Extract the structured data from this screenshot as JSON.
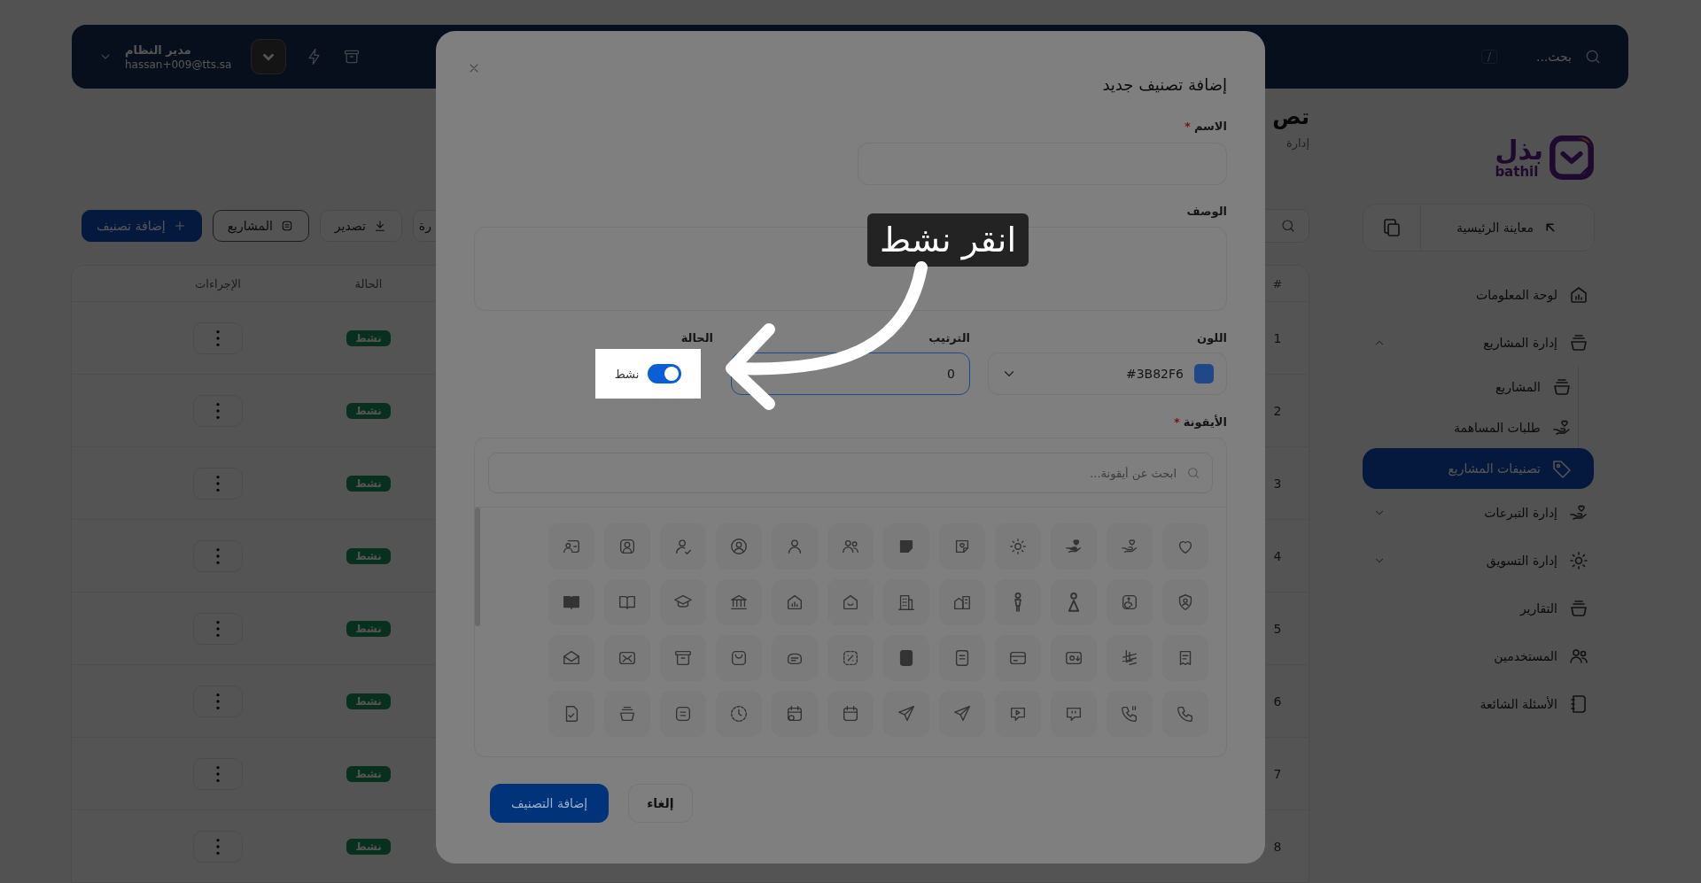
{
  "topbar": {
    "search_placeholder": "بحث...",
    "shortcut": "/",
    "user": {
      "name": "مدير النظام",
      "email": "hassan+009@tts.sa"
    }
  },
  "sidebar": {
    "logo": {
      "arabic": "بذل",
      "latin": "bathil"
    },
    "preview_button": "معاينة الرئيسية",
    "items": [
      {
        "label": "لوحة المعلومات",
        "selected": false
      },
      {
        "label": "إدارة المشاريع",
        "selected": false,
        "expanded": true,
        "children": [
          {
            "label": "المشاريع",
            "selected": false
          },
          {
            "label": "طلبات المساهمة",
            "selected": false
          },
          {
            "label": "تصنيفات المشاريع",
            "selected": true
          }
        ]
      },
      {
        "label": "إدارة التبرعات",
        "selected": false,
        "expanded": false
      },
      {
        "label": "إدارة التسويق",
        "selected": false,
        "expanded": false
      },
      {
        "label": "التقارير",
        "selected": false
      },
      {
        "label": "المستخدمين",
        "selected": false
      },
      {
        "label": "الأسئلة الشائعة",
        "selected": false
      }
    ]
  },
  "page": {
    "title": "تص",
    "subtitle": "إدارة",
    "toolbar": [
      {
        "kind": "filter",
        "label": "رة"
      },
      {
        "kind": "export",
        "label": "تصدير"
      },
      {
        "kind": "projects",
        "label": "المشاريع"
      },
      {
        "kind": "add",
        "label": "إضافة تصنيف"
      }
    ],
    "table": {
      "columns": [
        {
          "label": "#"
        },
        {
          "label": "الحالة"
        },
        {
          "label": "الإجراءات"
        }
      ],
      "rows": [
        {
          "number": "1",
          "status": "نشط",
          "active": true
        },
        {
          "number": "2",
          "status": "نشط",
          "active": true
        },
        {
          "number": "3",
          "status": "نشط",
          "active": true
        },
        {
          "number": "4",
          "status": "نشط",
          "active": true
        },
        {
          "number": "5",
          "status": "نشط",
          "active": true
        },
        {
          "number": "6",
          "status": "نشط",
          "active": true
        },
        {
          "number": "7",
          "status": "نشط",
          "active": true
        },
        {
          "number": "8",
          "status": "نشط",
          "active": true
        }
      ]
    }
  },
  "modal": {
    "title": "إضافة تصنيف جديد",
    "name_field": {
      "label": "الاسم",
      "required_mark": "*"
    },
    "description_field": {
      "label": "الوصف"
    },
    "color_field": {
      "label": "اللون",
      "value": "#3B82F6"
    },
    "order_field": {
      "label": "الترتيب",
      "value": "0",
      "focused": true
    },
    "status_field": {
      "label": "الحالة",
      "toggle_label": "نشط",
      "on": true
    },
    "icon_field": {
      "label": "الأيقونة",
      "required_mark": "*",
      "search_placeholder": "ابحث عن أيقونة..."
    },
    "buttons": [
      {
        "kind": "secondary",
        "label": "إلغاء"
      },
      {
        "kind": "primary",
        "label": "إضافة التصنيف"
      }
    ]
  },
  "tutorial": {
    "callout": "انقر نشط"
  }
}
